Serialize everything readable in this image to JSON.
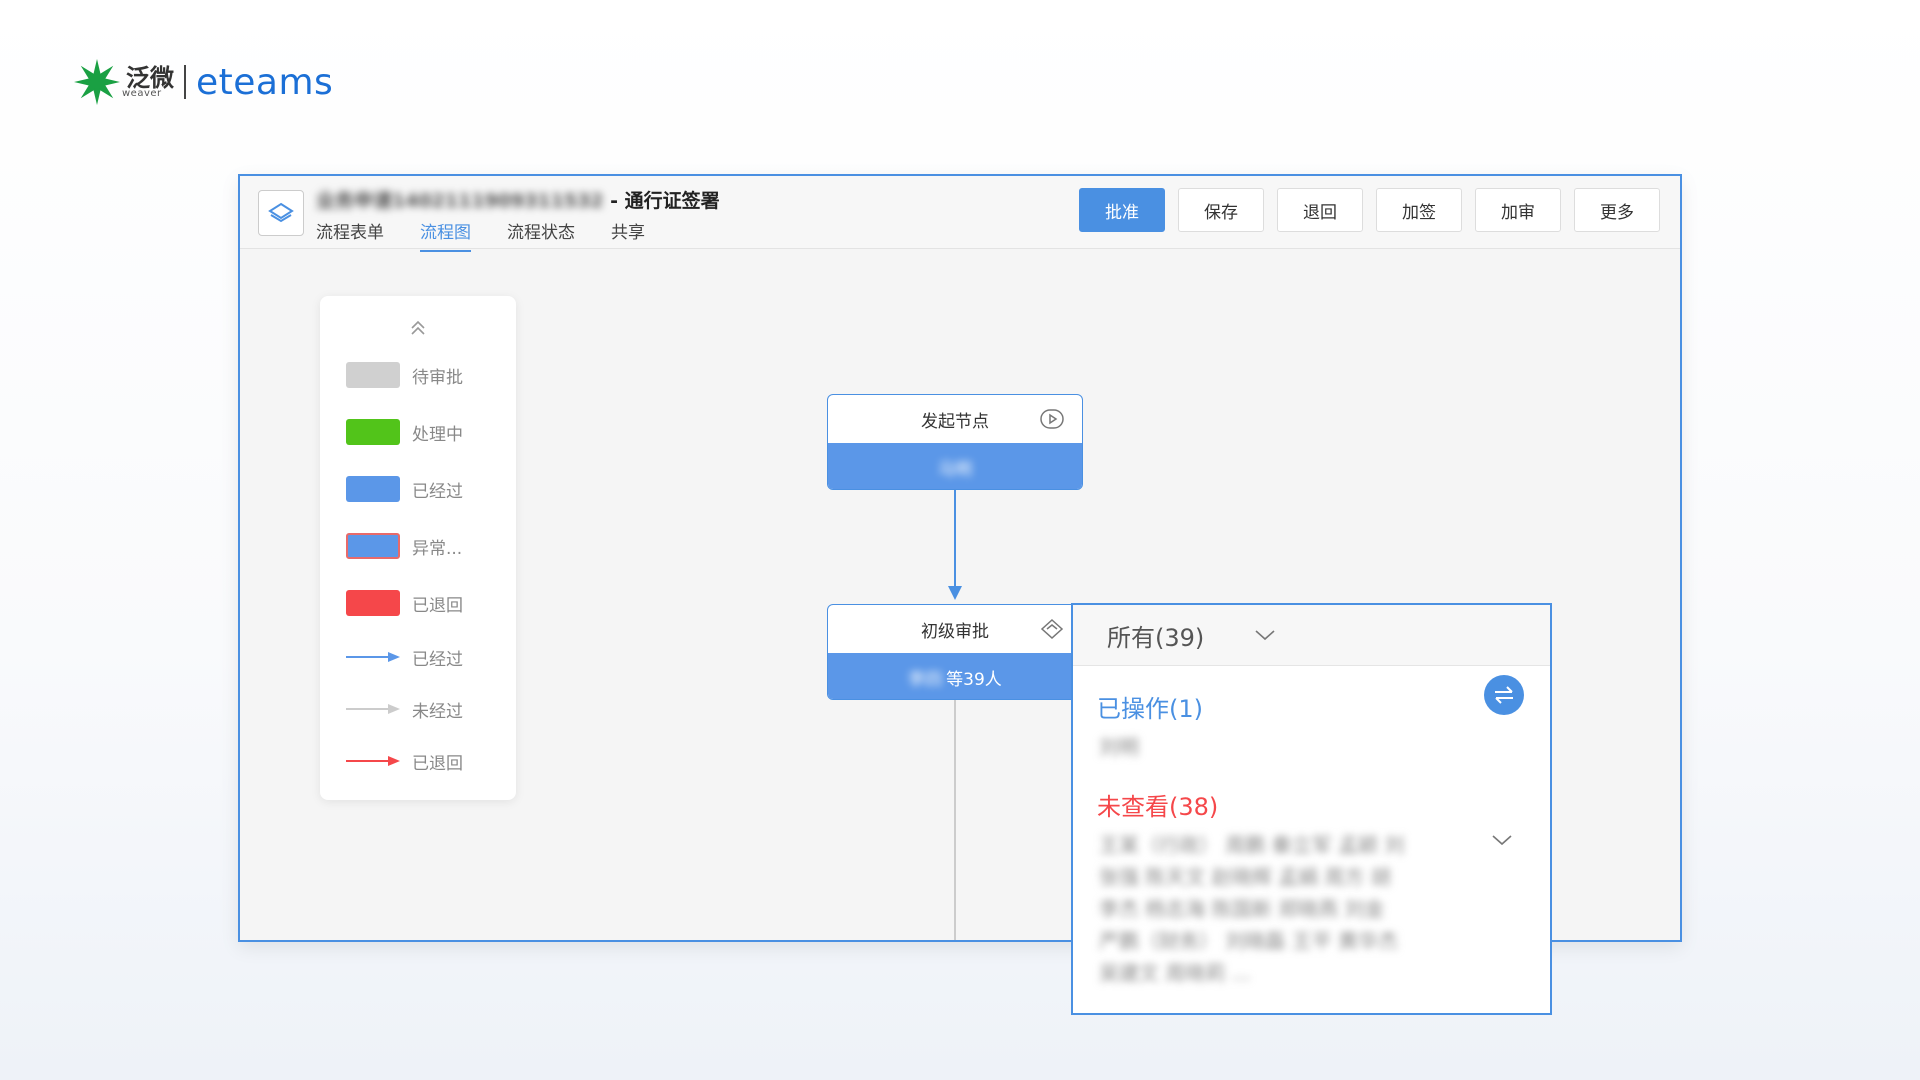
{
  "logo": {
    "cn": "泛微",
    "en_sub": "weaver",
    "product": "eteams"
  },
  "header": {
    "title_prefix": "业务申请1402111909311532",
    "title_suffix": "- 通行证签署",
    "tabs": [
      "流程表单",
      "流程图",
      "流程状态",
      "共享"
    ],
    "active_tab": 1,
    "buttons": [
      "批准",
      "保存",
      "退回",
      "加签",
      "加审",
      "更多"
    ]
  },
  "legend": {
    "items": [
      {
        "label": "待审批",
        "kind": "box",
        "color": "#d0d0d0"
      },
      {
        "label": "处理中",
        "kind": "box",
        "color": "#52c41a"
      },
      {
        "label": "已经过",
        "kind": "box",
        "color": "#5b97e8"
      },
      {
        "label": "异常...",
        "kind": "box-outline",
        "color": "#5b97e8",
        "border": "#e86a6a"
      },
      {
        "label": "已退回",
        "kind": "box",
        "color": "#f5474a"
      },
      {
        "label": "已经过",
        "kind": "arrow",
        "color": "#5b97e8"
      },
      {
        "label": "未经过",
        "kind": "arrow",
        "color": "#cccccc"
      },
      {
        "label": "已退回",
        "kind": "arrow",
        "color": "#f5474a"
      }
    ]
  },
  "flow": {
    "start_node": {
      "title": "发起节点",
      "assignee": "马明"
    },
    "approval_node": {
      "title": "初级审批",
      "assignee_blur": "李四",
      "assignee_suffix": "等39人"
    }
  },
  "panel": {
    "filter_label": "所有(39)",
    "operated_title": "已操作(1)",
    "operated_names": "刘明",
    "unread_title": "未查看(38)",
    "unread_lines": [
      "王某（行政）   周鹏   秦立军   孟颖   刘",
      "张强   陈天文   赵晓辉   孟娟   周方   胡",
      "李杰   杨志海   陈国新   郑晓燕   刘金",
      "严鹏（财务）   刘晓磊   王平   黄华杰",
      "吴建文   周晓莉   ..."
    ]
  },
  "colors": {
    "accent": "#4a90e2",
    "danger": "#f5474a",
    "logo_green": "#1aa043",
    "logo_blue": "#1b6fd6"
  }
}
